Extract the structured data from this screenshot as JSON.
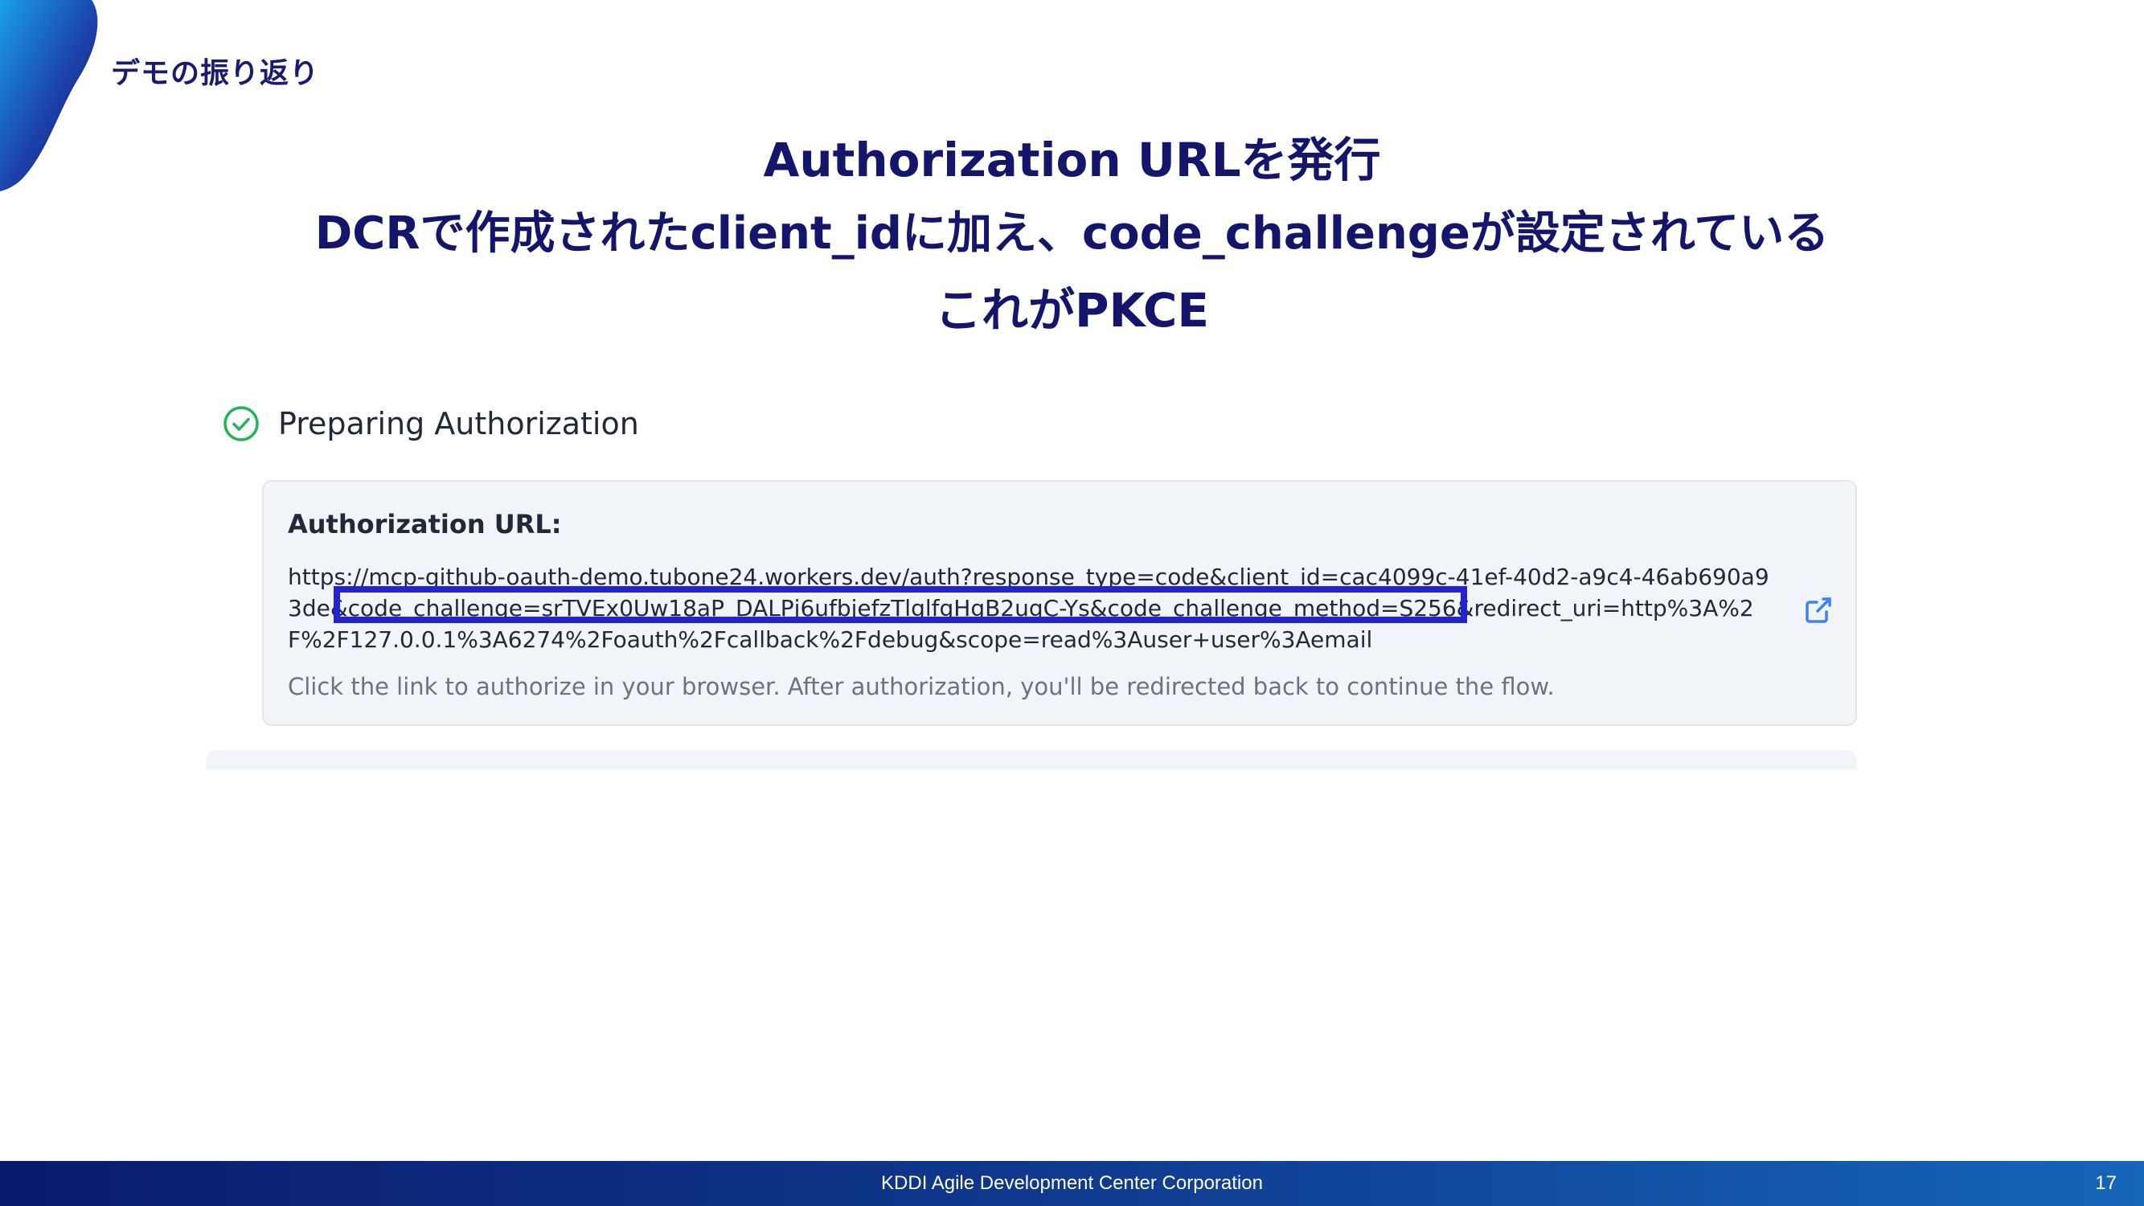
{
  "slide": {
    "section_label": "デモの振り返り",
    "headline_lines": [
      "Authorization URLを発行",
      "DCRで作成されたclient_idに加え、code_challengeが設定されている",
      "これがPKCE"
    ]
  },
  "step": {
    "title": "Preparing Authorization",
    "status_icon": "check-circle-icon",
    "status_color": "#22b35a"
  },
  "auth_card": {
    "heading": "Authorization URL:",
    "url_lines": [
      "https://mcp-github-oauth-demo.tubone24.workers.dev/auth?response_type=code&client_id=cac4099c-41ef-40d2-a9c4-46ab690a9",
      "3de&code_challenge=srTVEx0Uw18aP_DALPj6ufbjefzTlglfgHgB2ugC-Ys&code_challenge_method=S256&redirect_uri=http%3A%2",
      "F%2F127.0.0.1%3A6274%2Foauth%2Fcallback%2Fdebug&scope=read%3Auser+user%3Aemail"
    ],
    "hint": "Click the link to authorize in your browser. After authorization, you'll be redirected back to continue the flow.",
    "link_icon": "external-link-icon",
    "link_color": "#3b82f6",
    "highlight_color": "#2323d6"
  },
  "footer": {
    "company": "KDDI Agile Development Center Corporation",
    "page_number": "17"
  },
  "colors": {
    "heading": "#14166b",
    "accent_gradient_start": "#0a1a6e",
    "accent_gradient_end": "#1565b8"
  }
}
